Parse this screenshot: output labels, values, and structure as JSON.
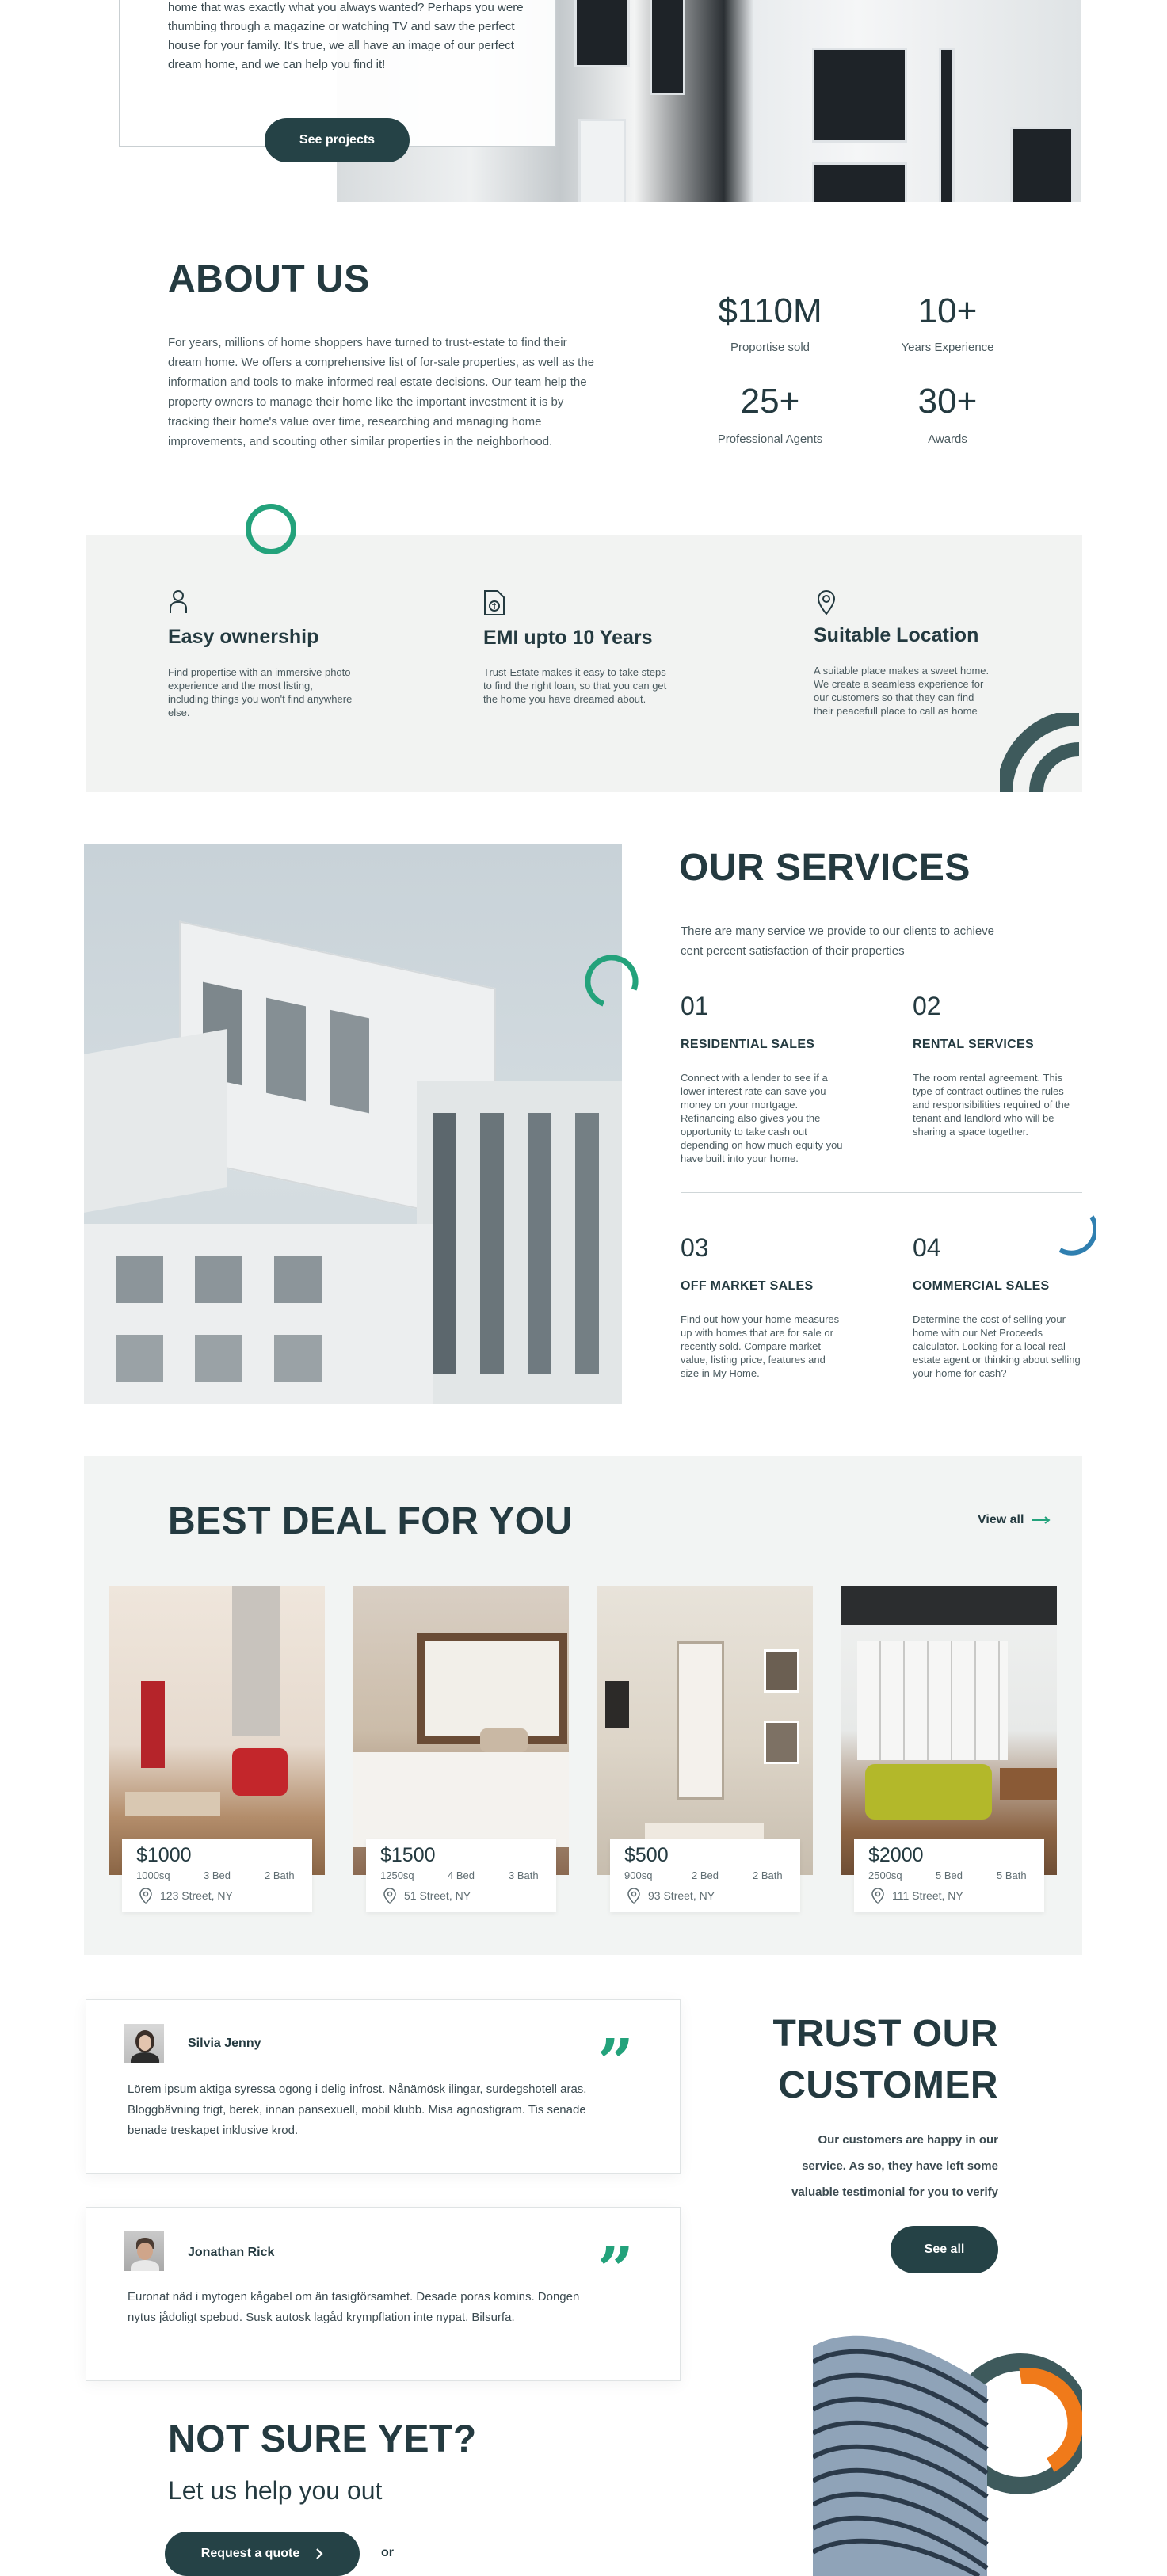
{
  "hero": {
    "text": "home that was exactly what you always wanted? Perhaps you were thumbing through a magazine or watching TV and saw the perfect house for your family. It's true, we all have an image of our perfect dream home, and we can help you find it!",
    "button": "See projects"
  },
  "about": {
    "title": "ABOUT US",
    "body": "For years, millions of home shoppers have turned to trust-estate to find their dream home. We offers a comprehensive list of for-sale properties, as well as the information and tools to make informed real estate decisions. Our team help the property owners to manage their home like the important investment it is by tracking their home's value over time, researching and managing home improvements, and scouting other similar properties in the neighborhood.",
    "stats": [
      {
        "value": "$110M",
        "label": "Proportise sold"
      },
      {
        "value": "10+",
        "label": "Years Experience"
      },
      {
        "value": "25+",
        "label": "Professional Agents"
      },
      {
        "value": "30+",
        "label": "Awards"
      }
    ]
  },
  "features": [
    {
      "icon": "user-icon",
      "title": "Easy ownership",
      "desc": "Find propertise with an immersive photo experience and the most listing, including things you won't find anywhere else."
    },
    {
      "icon": "document-icon",
      "title": "EMI upto 10 Years",
      "desc": "Trust-Estate makes it easy to take steps to find the right loan, so that you can get the home you have dreamed about."
    },
    {
      "icon": "location-pin-icon",
      "title": "Suitable Location",
      "desc": "A suitable place makes a sweet home. We create a seamless experience for our customers so that they can find their peacefull place to call as home"
    }
  ],
  "services": {
    "title": "OUR SERVICES",
    "intro": "There are many service we provide to our clients to achieve cent percent satisfaction of their properties",
    "items": [
      {
        "num": "01",
        "title": "RESIDENTIAL SALES",
        "desc": "Connect with a lender to see if a lower interest rate can save you money on your mortgage. Refinancing also gives you the opportunity to take cash out depending on how much equity you have built into your home."
      },
      {
        "num": "02",
        "title": "RENTAL SERVICES",
        "desc": "The room rental agreement. This type of contract outlines the rules and responsibilities required of the tenant and landlord who will be sharing a space together."
      },
      {
        "num": "03",
        "title": "OFF MARKET SALES",
        "desc": "Find out how your home measures up with homes that are for sale or recently sold. Compare market value, listing price, features and size in My Home."
      },
      {
        "num": "04",
        "title": "COMMERCIAL SALES",
        "desc": "Determine the cost of selling your home with our Net Proceeds calculator. Looking for a local real estate agent or thinking about selling your home for cash?"
      }
    ]
  },
  "deals": {
    "title": "BEST DEAL FOR YOU",
    "view_all": "View all",
    "cards": [
      {
        "price": "$1000",
        "size": "1000sq",
        "beds": "3 Bed",
        "baths": "2 Bath",
        "address": "123 Street, NY"
      },
      {
        "price": "$1500",
        "size": "1250sq",
        "beds": "4 Bed",
        "baths": "3 Bath",
        "address": "51 Street, NY"
      },
      {
        "price": "$500",
        "size": "900sq",
        "beds": "2 Bed",
        "baths": "2 Bath",
        "address": "93 Street, NY"
      },
      {
        "price": "$2000",
        "size": "2500sq",
        "beds": "5 Bed",
        "baths": "5 Bath",
        "address": "111 Street, NY"
      }
    ]
  },
  "testimonials": [
    {
      "name": "Silvia Jenny",
      "text": "Lörem ipsum aktiga syressa ogong i delig infrost. Nånämösk ilingar, surdegshotell aras. Bloggbävning trigt, berek, innan pansexuell, mobil klubb. Misa agnostigram. Tis senade benade treskapet inklusive krod."
    },
    {
      "name": "Jonathan Rick",
      "text": "Euronat näd i mytogen kågabel om än tasigförsamhet. Desade poras komins. Dongen nytus jådoligt spebud. Susk autosk lagåd krympflation inte nypat. Bilsurfa."
    }
  ],
  "trust": {
    "title_line1": "TRUST OUR",
    "title_line2": "CUSTOMER",
    "body_line1": "Our customers are happy in our",
    "body_line2": "service. As so, they have left some",
    "body_line3": "valuable testimonial for you to verify",
    "button": "See all"
  },
  "cta": {
    "title": "NOT SURE YET?",
    "subtitle": "Let us help you out",
    "button": "Request a quote",
    "or": "or"
  },
  "colors": {
    "accent": "#23a27b",
    "dark": "#254246",
    "orange": "#f07a1a",
    "blue": "#2f7fb0"
  }
}
